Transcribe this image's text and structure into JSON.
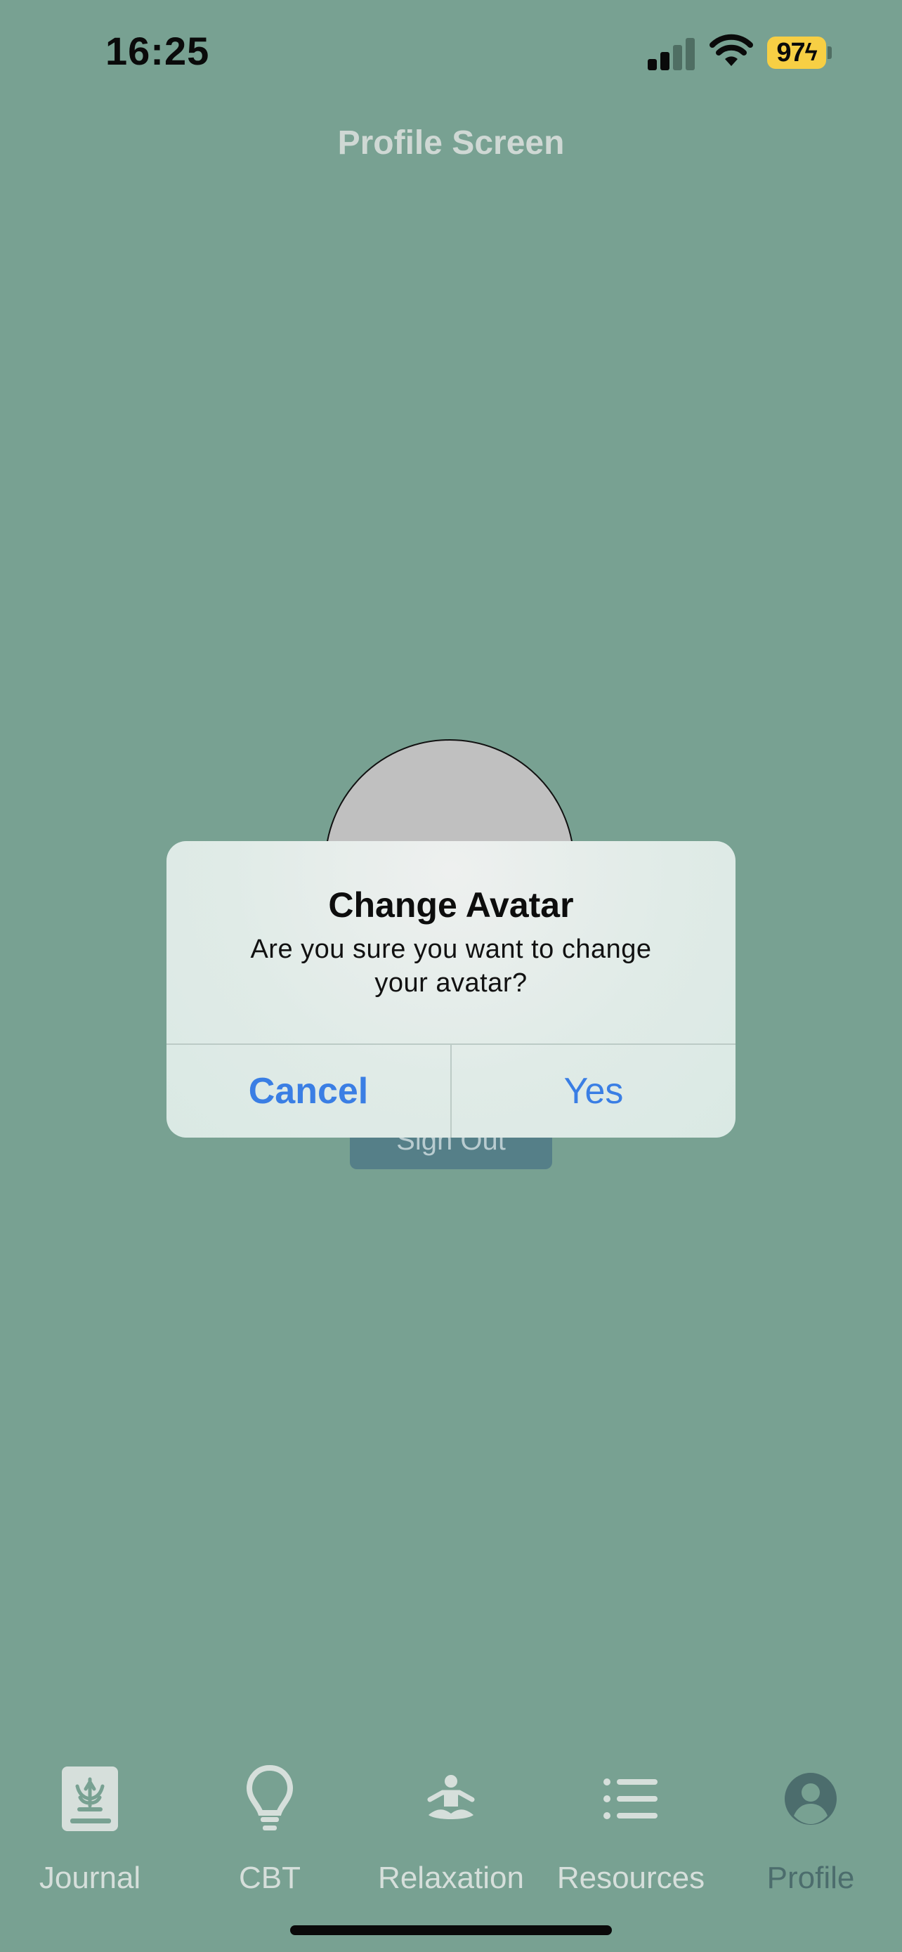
{
  "status_bar": {
    "time": "16:25",
    "battery": "97",
    "icons": [
      "signal-icon",
      "wifi-icon",
      "battery-charging-icon"
    ]
  },
  "header": {
    "title": "Profile Screen"
  },
  "profile": {
    "avatar": "avatar-placeholder",
    "sign_out_label": "Sign Out"
  },
  "alert": {
    "title": "Change Avatar",
    "message": "Are you sure you want to change your avatar?",
    "cancel_label": "Cancel",
    "confirm_label": "Yes"
  },
  "tab_bar": {
    "items": [
      {
        "label": "Journal",
        "icon": "journal-book-icon"
      },
      {
        "label": "CBT",
        "icon": "lightbulb-icon"
      },
      {
        "label": "Relaxation",
        "icon": "meditation-icon"
      },
      {
        "label": "Resources",
        "icon": "list-icon"
      },
      {
        "label": "Profile",
        "icon": "person-circle-icon"
      }
    ],
    "active": "Profile"
  },
  "colors": {
    "background": "#78a192",
    "alert_accent": "#3a7ee4",
    "tab_inactive": "#d6dfdb",
    "tab_active": "#4c6d6d",
    "battery": "#f7cf44"
  }
}
